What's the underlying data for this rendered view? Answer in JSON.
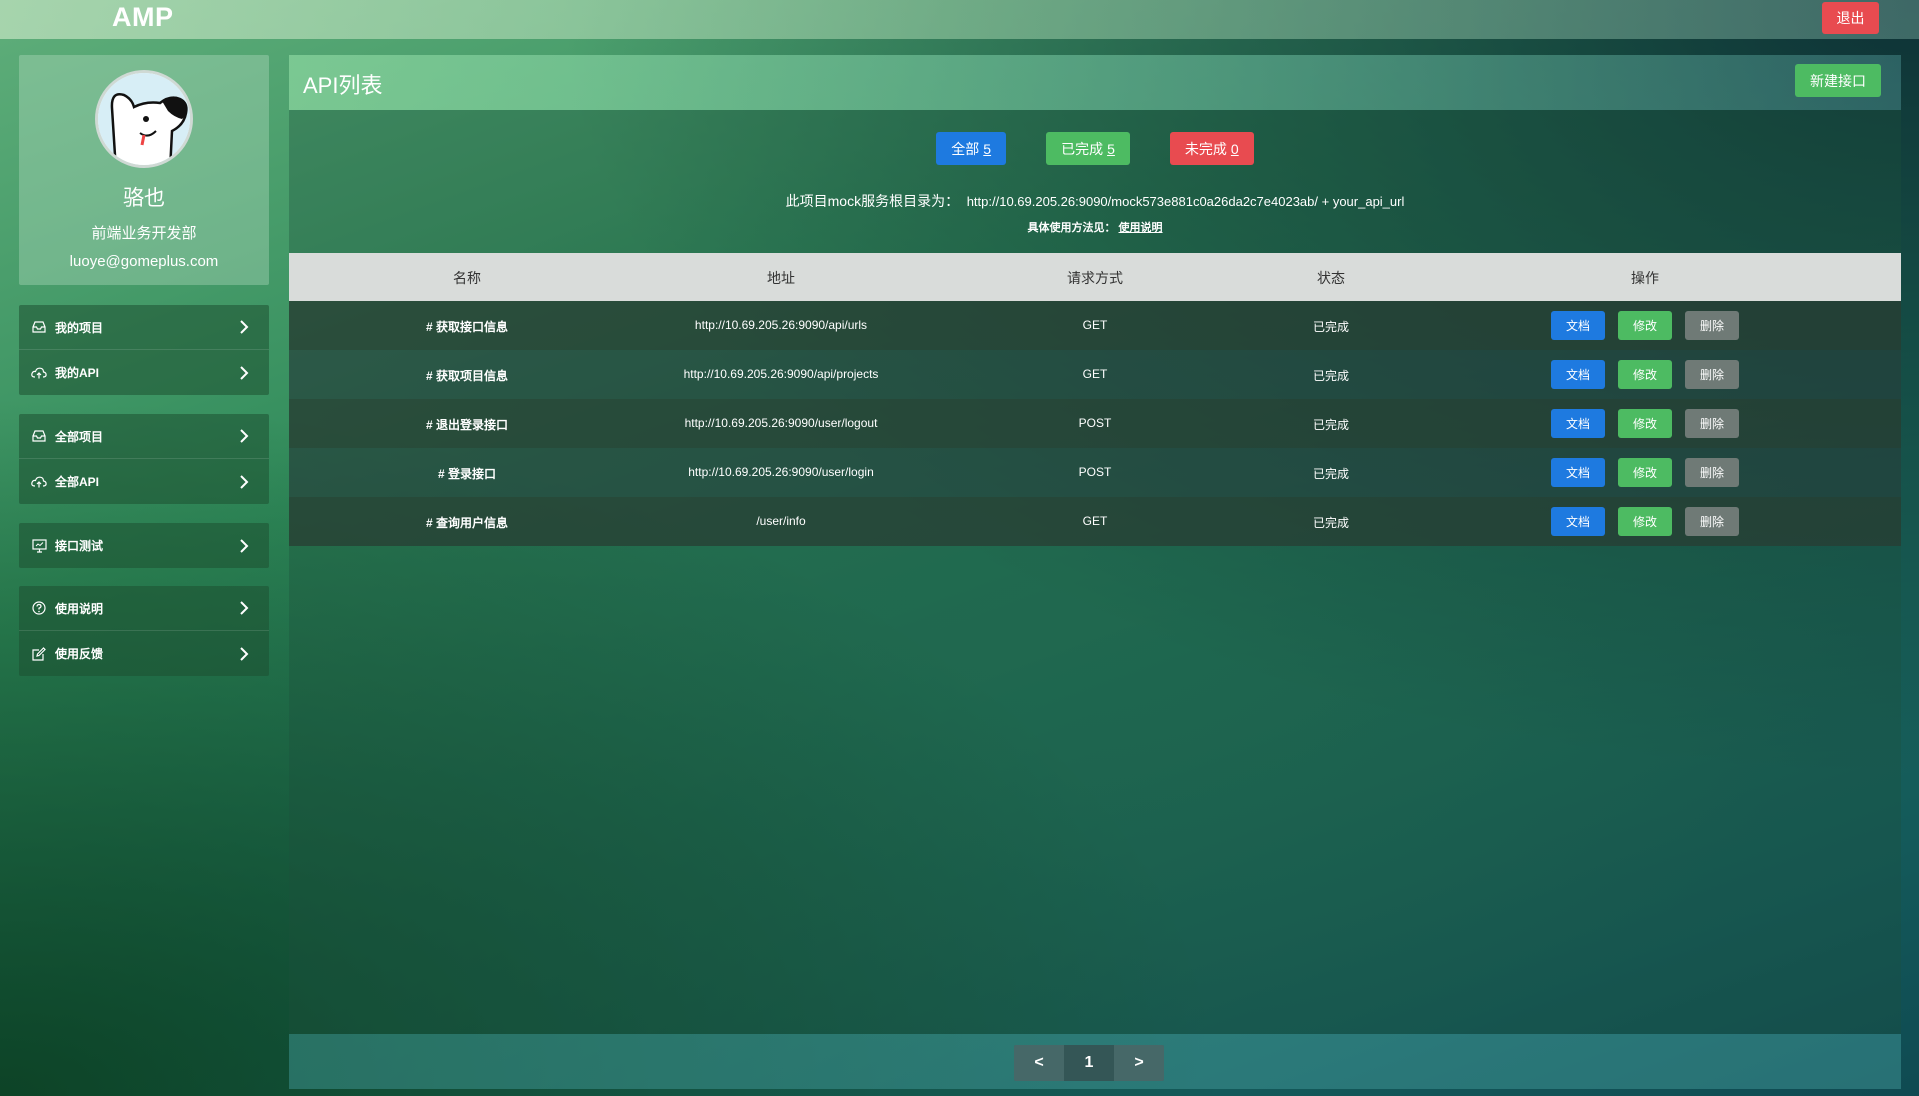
{
  "app": {
    "logo": "AMP",
    "logout_label": "退出"
  },
  "profile": {
    "name": "骆也",
    "department": "前端业务开发部",
    "email": "luoye@gomeplus.com"
  },
  "sidebar": {
    "groups": [
      {
        "items": [
          {
            "label": "我的项目",
            "icon": "inbox-icon"
          },
          {
            "label": "我的API",
            "icon": "cloud-upload-icon"
          }
        ]
      },
      {
        "items": [
          {
            "label": "全部项目",
            "icon": "inbox-icon"
          },
          {
            "label": "全部API",
            "icon": "cloud-upload-icon"
          }
        ]
      },
      {
        "items": [
          {
            "label": "接口测试",
            "icon": "monitor-icon"
          }
        ]
      },
      {
        "items": [
          {
            "label": "使用说明",
            "icon": "question-circle-icon"
          },
          {
            "label": "使用反馈",
            "icon": "edit-icon"
          }
        ]
      }
    ]
  },
  "main": {
    "title": "API列表",
    "new_button_label": "新建接口",
    "filters": {
      "all": {
        "label": "全部",
        "count": "5"
      },
      "done": {
        "label": "已完成",
        "count": "5"
      },
      "undone": {
        "label": "未完成",
        "count": "0"
      }
    },
    "mock": {
      "label": "此项目mock服务根目录为：",
      "url": "http://10.69.205.26:9090/mock573e881c0a26da2c7e4023ab/ + your_api_url"
    },
    "usage": {
      "label": "具体使用方法见：",
      "link": "使用说明"
    }
  },
  "table": {
    "headers": {
      "name": "名称",
      "url": "地址",
      "method": "请求方式",
      "status": "状态",
      "actions": "操作"
    },
    "actions": {
      "doc": "文档",
      "edit": "修改",
      "delete": "删除"
    },
    "rows": [
      {
        "name": "# 获取接口信息",
        "url": "http://10.69.205.26:9090/api/urls",
        "method": "GET",
        "status": "已完成"
      },
      {
        "name": "# 获取项目信息",
        "url": "http://10.69.205.26:9090/api/projects",
        "method": "GET",
        "status": "已完成"
      },
      {
        "name": "# 退出登录接口",
        "url": "http://10.69.205.26:9090/user/logout",
        "method": "POST",
        "status": "已完成"
      },
      {
        "name": "# 登录接口",
        "url": "http://10.69.205.26:9090/user/login",
        "method": "POST",
        "status": "已完成"
      },
      {
        "name": "# 查询用户信息",
        "url": "/user/info",
        "method": "GET",
        "status": "已完成"
      }
    ]
  },
  "pagination": {
    "prev": "<",
    "current": "1",
    "next": ">"
  },
  "colors": {
    "primary": "#1e7ae0",
    "success": "#4dbb62",
    "danger": "#e84b50",
    "neutral": "#6f7a76"
  }
}
